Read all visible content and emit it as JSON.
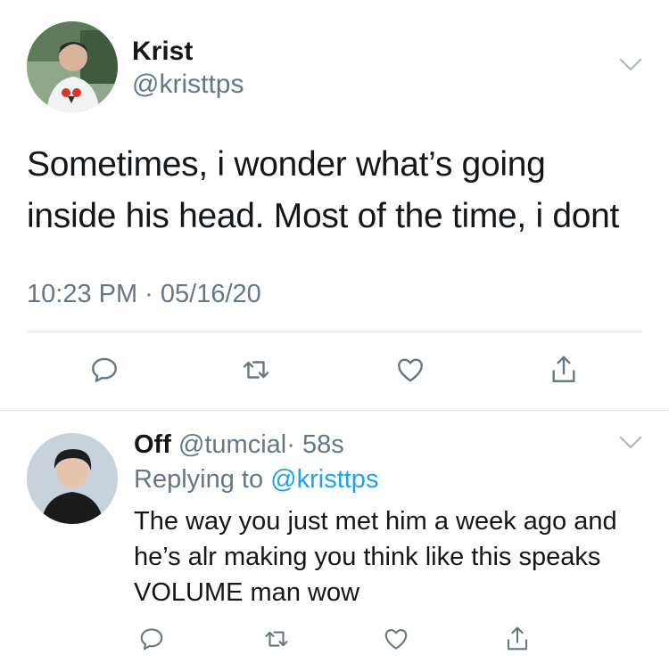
{
  "main_tweet": {
    "author_name": "Krist",
    "author_handle": "@kristtps",
    "text_line1": "Sometimes, i wonder what’s going",
    "text_line2": "inside his head. Most of the time, i dont",
    "timestamp": "10:23 PM · 05/16/20"
  },
  "reply_tweet": {
    "author_name": "Off",
    "author_handle": "@tumcial",
    "time_ago": "· 58s",
    "replying_prefix": "Replying to",
    "replying_handle": "@kristtps",
    "text_line1": "The way you just met him a week ago and",
    "text_line2": "he’s alr making you think like this speaks",
    "text_line3": "VOLUME man wow"
  },
  "actions": [
    "reply-icon",
    "retweet-icon",
    "like-icon",
    "share-icon"
  ],
  "colors": {
    "text": "#14171a",
    "secondary": "#657786",
    "link": "#1da1f2",
    "divider": "#e1e8ed",
    "icon": "#657786"
  }
}
